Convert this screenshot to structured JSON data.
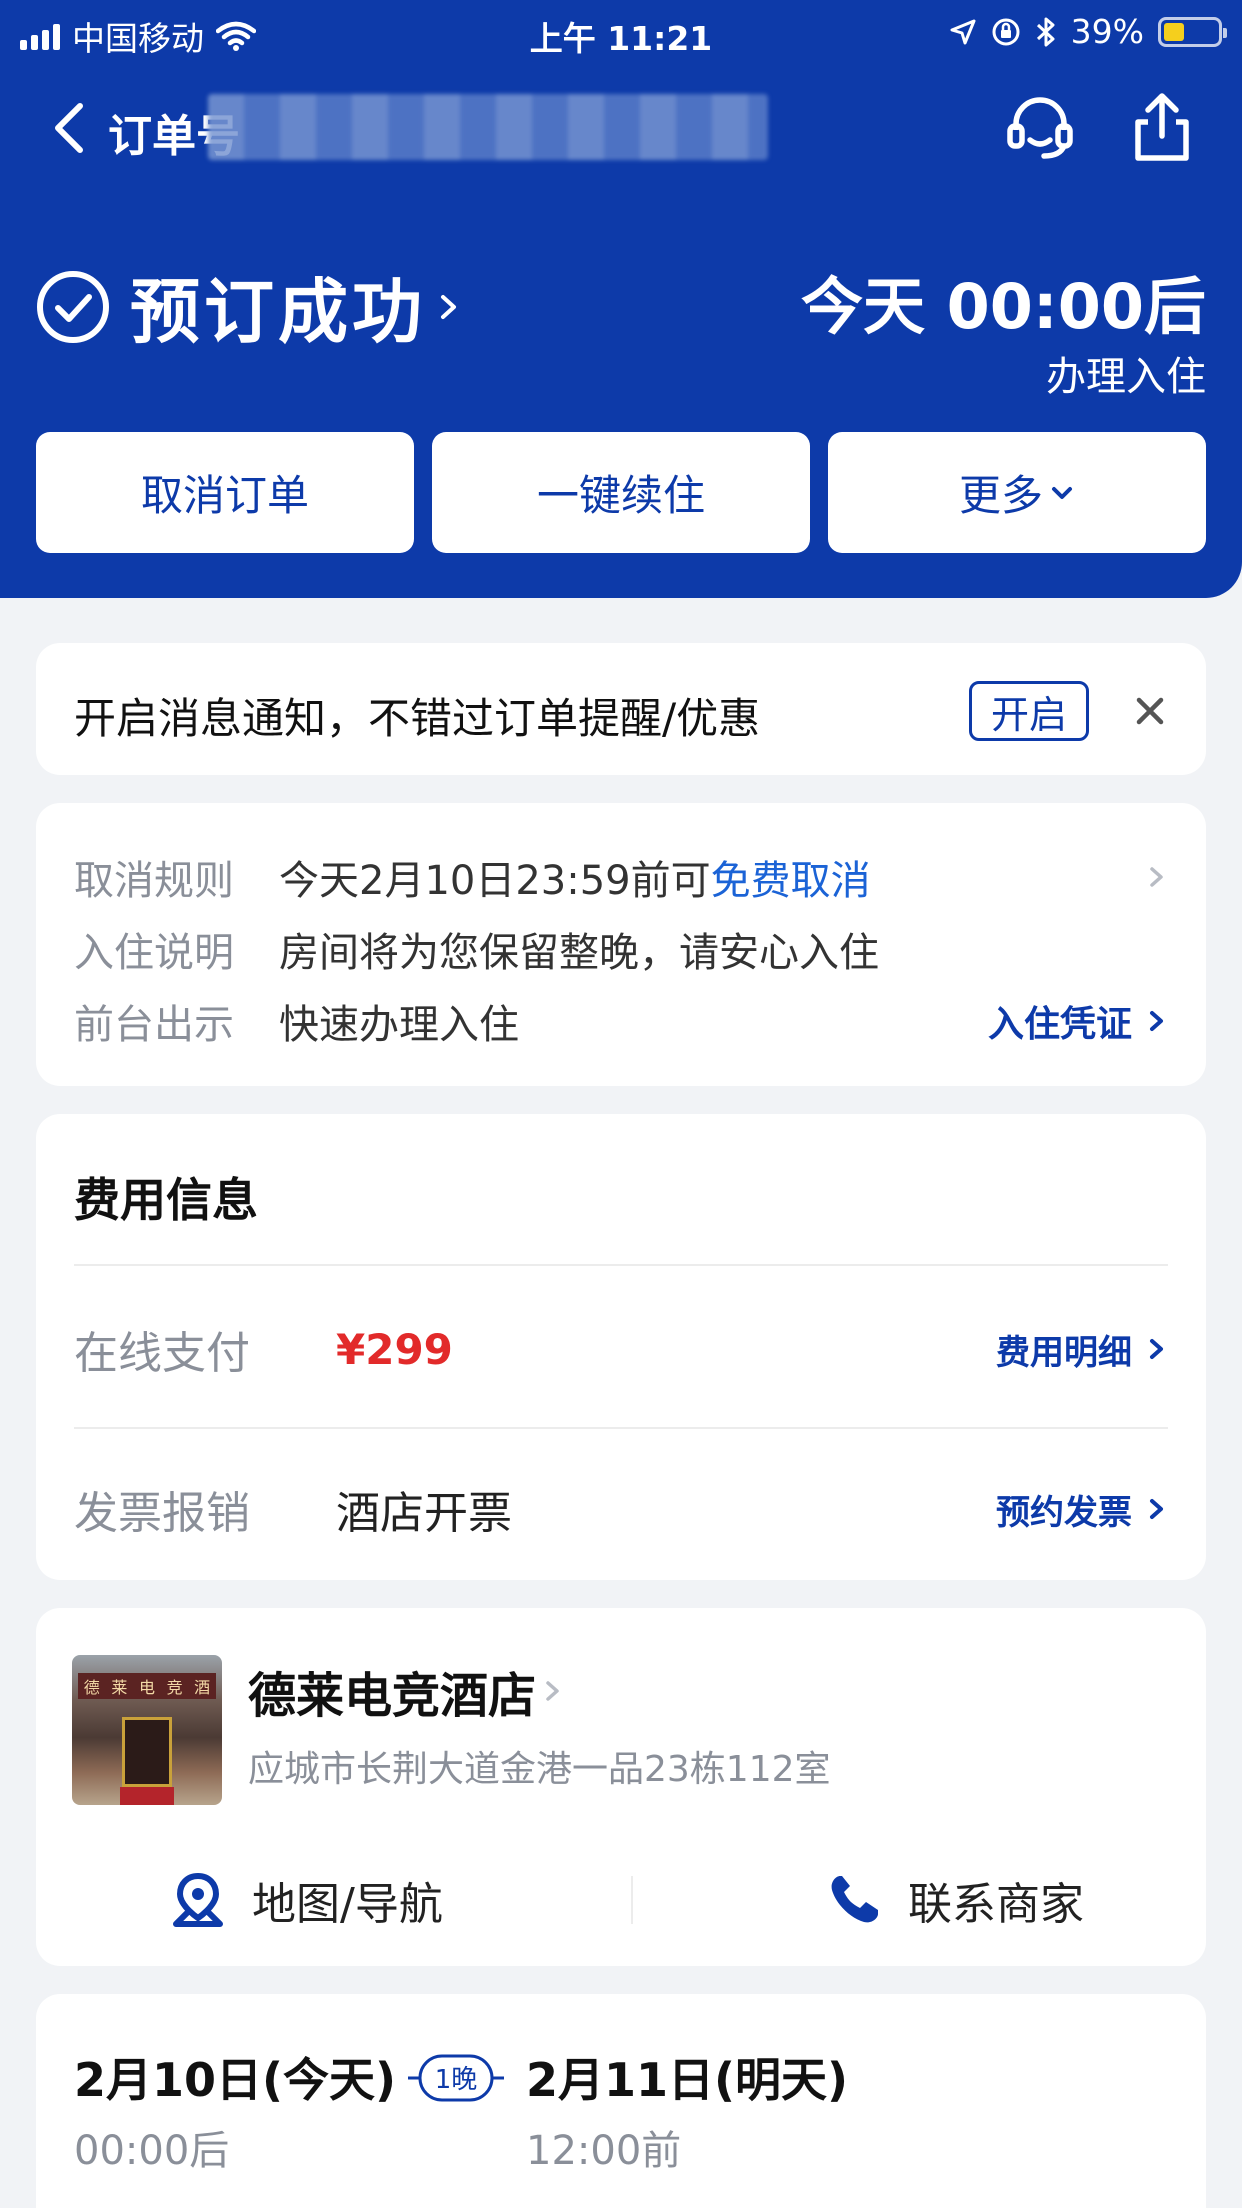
{
  "statusbar": {
    "carrier": "中国移动",
    "time": "上午 11:21",
    "battery": "39%",
    "battery_level": 0.39
  },
  "navbar": {
    "order_label": "订单号"
  },
  "booking": {
    "status": "预订成功",
    "checkin_time": "今天 00:00后",
    "checkin_sub": "办理入住"
  },
  "actions": {
    "cancel": "取消订单",
    "extend": "一键续住",
    "more": "更多"
  },
  "notify": {
    "text": "开启消息通知，不错过订单提醒/优惠",
    "open": "开启"
  },
  "rules": {
    "cancel_key": "取消规则",
    "cancel_value": "今天2月10日23:59前可",
    "cancel_highlight": "免费取消",
    "checkin_key": "入住说明",
    "checkin_value": "房间将为您保留整晚，请安心入住",
    "front_key": "前台出示",
    "front_value": "快速办理入住",
    "voucher_link": "入住凭证"
  },
  "fee": {
    "title": "费用信息",
    "online_key": "在线支付",
    "price": "¥299",
    "detail_link": "费用明细",
    "invoice_key": "发票报销",
    "invoice_value": "酒店开票",
    "invoice_link": "预约发票"
  },
  "hotel": {
    "name": "德莱电竞酒店",
    "address": "应城市长荆大道金港一品23栋112室",
    "map": "地图/导航",
    "contact": "联系商家",
    "sign_chars": [
      "德",
      "莱",
      "电",
      "竞",
      "酒"
    ]
  },
  "stay": {
    "checkin_date": "2月10日(今天)",
    "checkin_time": "00:00后",
    "nights": "1晚",
    "checkout_date": "2月11日(明天)",
    "checkout_time": "12:00前"
  },
  "colors": {
    "brand_blue": "#0d3aa9",
    "link_blue": "#1b63d6",
    "price_red": "#e22a2a",
    "battery_yellow": "#f5cf1d"
  }
}
